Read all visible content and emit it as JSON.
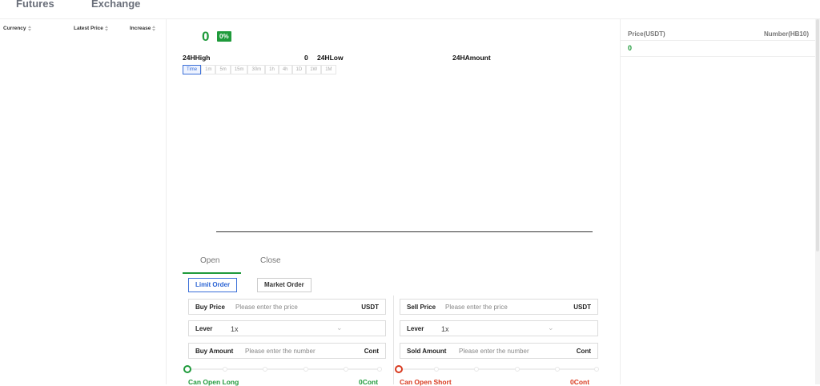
{
  "nav": {
    "tabs": [
      "Futures",
      "Exchange"
    ]
  },
  "market_list": {
    "columns": [
      "Currency",
      "Latest Price",
      "Increase"
    ]
  },
  "ticker": {
    "price": "0",
    "change_pct": "0%",
    "high_label": "24HHigh",
    "high_value": "0",
    "low_label": "24HLow",
    "amount_label": "24HAmount"
  },
  "timeframes": [
    "Time",
    "1m",
    "5m",
    "15m",
    "30m",
    "1h",
    "4h",
    "1D",
    "1W",
    "1M"
  ],
  "order_panel": {
    "tabs": [
      "Open",
      "Close"
    ],
    "types": [
      "Limit Order",
      "Market Order"
    ],
    "buy": {
      "price_label": "Buy Price",
      "price_placeholder": "Please enter the price",
      "price_unit": "USDT",
      "lever_label": "Lever",
      "lever_value": "1x",
      "amount_label": "Buy Amount",
      "amount_placeholder": "Please enter the number",
      "amount_unit": "Cont",
      "can_open_label": "Can Open Long",
      "can_open_value": "0Cont"
    },
    "sell": {
      "price_label": "Sell Price",
      "price_placeholder": "Please enter the price",
      "price_unit": "USDT",
      "lever_label": "Lever",
      "lever_value": "1x",
      "amount_label": "Sold Amount",
      "amount_placeholder": "Please enter the number",
      "amount_unit": "Cont",
      "can_open_label": "Can Open Short",
      "can_open_value": "0Cont"
    }
  },
  "orderbook": {
    "price_header": "Price(USDT)",
    "number_header": "Number(HB10)",
    "value": "0"
  },
  "colors": {
    "green": "#1f9a3b",
    "red": "#d83a1f",
    "blue": "#3a6fd8"
  }
}
